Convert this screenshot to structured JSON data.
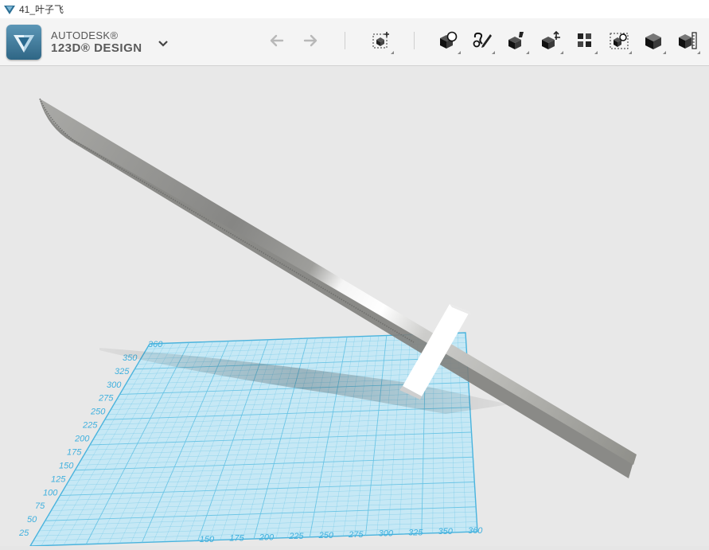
{
  "window": {
    "title": "41_叶子飞"
  },
  "app": {
    "brand_top": "AUTODESK®",
    "brand_bottom": "123D® DESIGN"
  },
  "toolbar": {
    "tools": [
      {
        "name": "undo-icon"
      },
      {
        "name": "redo-icon"
      },
      {
        "name": "transform-icon"
      },
      {
        "name": "primitives-icon"
      },
      {
        "name": "sketch-icon"
      },
      {
        "name": "construct-icon"
      },
      {
        "name": "modify-icon"
      },
      {
        "name": "pattern-icon"
      },
      {
        "name": "group-icon"
      },
      {
        "name": "combine-icon"
      },
      {
        "name": "measure-icon"
      }
    ]
  },
  "grid": {
    "y_ticks": [
      "25",
      "50",
      "75",
      "100",
      "125",
      "150",
      "175",
      "200",
      "225",
      "250",
      "275",
      "300",
      "325",
      "350"
    ],
    "x_ticks": [
      "150",
      "175",
      "200",
      "225",
      "250",
      "275",
      "300",
      "325",
      "350",
      "360"
    ],
    "corner_label": "360"
  },
  "colors": {
    "grid_line": "#63c2e4",
    "grid_fill": "#bfe5f3",
    "blade": "#b5b5b2",
    "accent": "#2c6f95"
  }
}
